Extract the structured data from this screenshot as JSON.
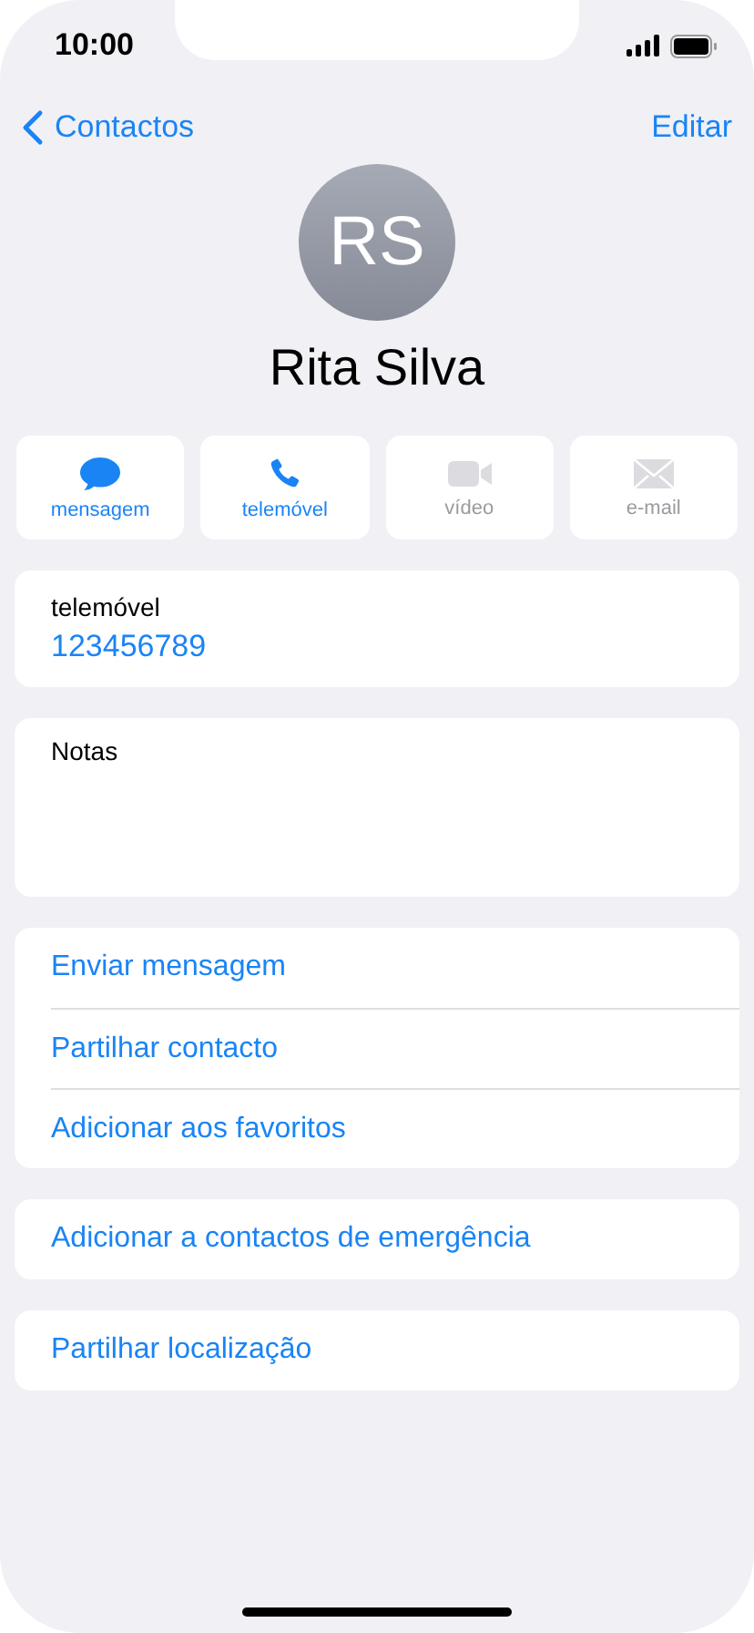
{
  "status_bar": {
    "time": "10:00"
  },
  "nav": {
    "back": "Contactos",
    "edit": "Editar"
  },
  "contact": {
    "initials": "RS",
    "name": "Rita Silva"
  },
  "actions": [
    {
      "kind": "message",
      "label": "mensagem",
      "disabled": false
    },
    {
      "kind": "phone",
      "label": "telemóvel",
      "disabled": false
    },
    {
      "kind": "video",
      "label": "vídeo",
      "disabled": true
    },
    {
      "kind": "mail",
      "label": "e-mail",
      "disabled": true
    }
  ],
  "phone": {
    "label": "telemóvel",
    "value": "123456789"
  },
  "notes": {
    "label": "Notas"
  },
  "groups": [
    [
      "Enviar mensagem",
      "Partilhar contacto",
      "Adicionar aos favoritos"
    ],
    [
      "Adicionar a contactos de emergência"
    ],
    [
      "Partilhar localização"
    ]
  ]
}
